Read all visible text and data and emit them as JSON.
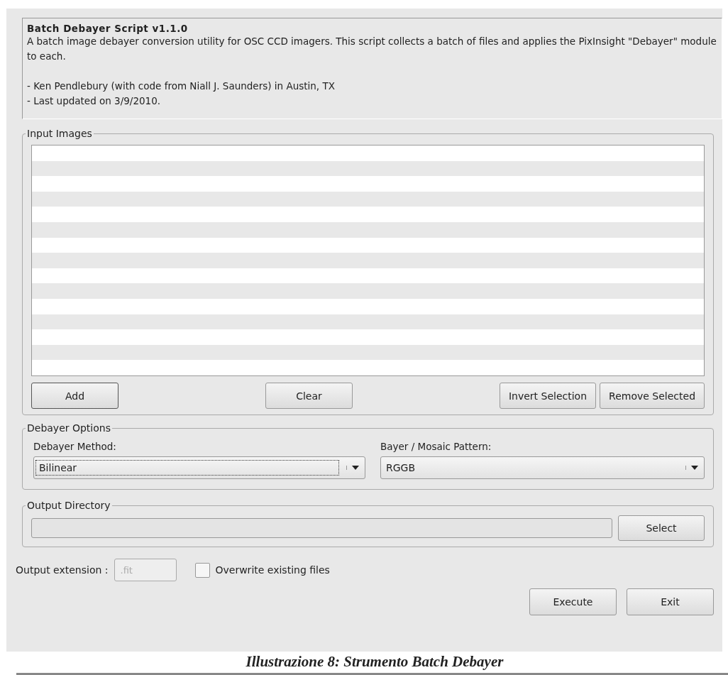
{
  "header": {
    "title": "Batch Debayer Script v1.1.0",
    "description": "A batch image debayer conversion utility for OSC CCD imagers. This script collects a batch of files and applies the PixInsight \"Debayer\" module to each.",
    "credits": [
      "- Ken Pendlebury (with code from Niall J. Saunders) in Austin, TX",
      "- Last updated on 3/9/2010."
    ]
  },
  "input_images": {
    "title": "Input Images",
    "buttons": [
      {
        "label": "Add"
      },
      {
        "label": "Clear"
      },
      {
        "label": "Invert Selection"
      },
      {
        "label": "Remove Selected"
      }
    ]
  },
  "debayer_options": {
    "title": "Debayer Options",
    "method": {
      "label": "Debayer Method:",
      "value": "Bilinear"
    },
    "pattern": {
      "label": "Bayer / Mosaic Pattern:",
      "value": "RGGB"
    }
  },
  "output_directory": {
    "title": "Output Directory",
    "button": "Select"
  },
  "output_extension": {
    "label": "Output extension :",
    "placeholder": ".fit"
  },
  "overwrite": {
    "label": "Overwrite existing files",
    "checked": false
  },
  "actions": [
    "Execute",
    "Exit"
  ],
  "caption": "Illustrazione 8: Strumento Batch Debayer"
}
